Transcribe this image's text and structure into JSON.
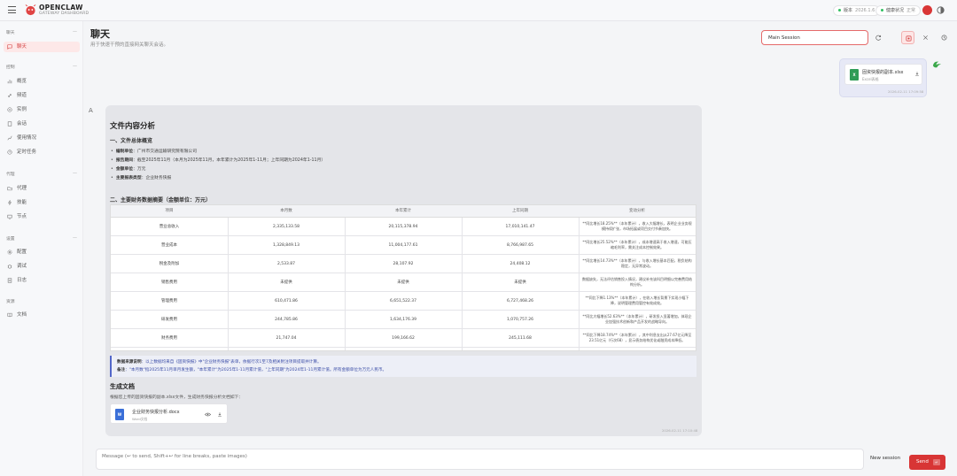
{
  "brand": {
    "title": "OPENCLAW",
    "subtitle": "GATEWAY DASHBOARD"
  },
  "topbar": {
    "version_label": "版本",
    "version_value": "2026.1.6",
    "health_label": "健康状况",
    "health_value": "正常",
    "status_color": "#2fbf5f"
  },
  "sidebar": {
    "sections": [
      {
        "label": "聊天",
        "items": [
          {
            "label": "聊天",
            "icon": "chat-icon",
            "active": true
          }
        ]
      },
      {
        "label": "控制",
        "items": [
          {
            "label": "概览",
            "icon": "bar-chart-icon"
          },
          {
            "label": "频道",
            "icon": "link-icon"
          },
          {
            "label": "实例",
            "icon": "radio-icon"
          },
          {
            "label": "会话",
            "icon": "document-icon"
          },
          {
            "label": "使用情况",
            "icon": "chart-icon"
          },
          {
            "label": "定时任务",
            "icon": "clock-icon"
          }
        ]
      },
      {
        "label": "代理",
        "items": [
          {
            "label": "代理",
            "icon": "folder-icon"
          },
          {
            "label": "技能",
            "icon": "bolt-icon"
          },
          {
            "label": "节点",
            "icon": "monitor-icon"
          }
        ]
      },
      {
        "label": "设置",
        "items": [
          {
            "label": "配置",
            "icon": "gear-icon"
          },
          {
            "label": "调试",
            "icon": "bug-icon"
          },
          {
            "label": "日志",
            "icon": "log-icon"
          }
        ]
      },
      {
        "label": "资源",
        "items": [
          {
            "label": "文档",
            "icon": "book-icon"
          }
        ]
      }
    ]
  },
  "page": {
    "title": "聊天",
    "subtitle": "用于快速干预的直接网关聊天会话。"
  },
  "session": {
    "value": "Main Session"
  },
  "user_message": {
    "file_name": "固资快报的副本.xlsx",
    "file_type": "Excel表格",
    "time": "2026-02-11 17:09:58"
  },
  "assistant": {
    "title": "文件内容分析",
    "section1": "一、文件总体概览",
    "overview": [
      {
        "key": "编制单位",
        "value": "广州市交通运输研究院有限公司"
      },
      {
        "key": "报告期间",
        "value": "截至2025年11月（本月为2025年11月，本年累计为2025年1-11月；上年同期为2024年1-11月）"
      },
      {
        "key": "金额单位",
        "value": "万元"
      },
      {
        "key": "主要报表类型",
        "value": "企业财务快报"
      }
    ],
    "section2": "二、主要财务数据摘要（金额单位：万元）",
    "table": {
      "headers": [
        "项目",
        "本月数",
        "本年累计",
        "上年同期",
        "变动分析"
      ],
      "rows": [
        {
          "item": "营业总收入",
          "month": "2,335,133.58",
          "ytd": "20,115,378.94",
          "prior": "17,010,141.47",
          "analysis": "**同比增长18.25%**（本年累计），收入大幅增长，表明企业业务规模持续扩张，市场拓展或项目交付节奏加快。"
        },
        {
          "item": "营业成本",
          "month": "1,328,849.13",
          "ytd": "11,004,177.61",
          "prior": "8,766,987.65",
          "analysis": "**同比增长25.52%**（本年累计），成本增速高于收入增速，可能压缩毛利率，需关注成本控制效果。"
        },
        {
          "item": "税金及附加",
          "month": "2,533.87",
          "ytd": "28,107.92",
          "prior": "24,408.12",
          "analysis": "**同比增长14.73%**（本年累计），与收入增长基本匹配，税负结构稳定，无异常波动。"
        },
        {
          "item": "销售费用",
          "month": "未提供",
          "ytd": "未提供",
          "prior": "未提供",
          "analysis": "数据缺失，无法评估销售投入情况，建议补充该科目明细以完善费用结构分析。"
        },
        {
          "item": "管理费用",
          "month": "610,471.86",
          "ytd": "6,651,522.37",
          "prior": "6,727,468.26",
          "analysis": "**同比下降1.13%**（本年累计），在收入增长背景下实现小幅下降，说明管理费用管控有效成效。"
        },
        {
          "item": "研发费用",
          "month": "244,785.86",
          "ytd": "1,634,176.39",
          "prior": "1,070,757.26",
          "analysis": "**同比大幅增长52.63%**（本年累计），研发投入显著增加，体现企业加强技术创新和产品开发的战略导向。"
        },
        {
          "item": "财务费用",
          "month": "21,747.04",
          "ytd": "199,166.62",
          "prior": "245,111.68",
          "analysis": "**同比下降18.74%**（本年累计），其中利息支出从27.67亿元降至23.51亿元（行次68），显示债务结构优化或融资成本降低。"
        }
      ]
    },
    "note": {
      "source_label": "数据来源说明",
      "source_text": "：以上数据均来自《固资快报》中\"企业财务快报\"表单，依据行次1至7及相关附注项目提取并计算。",
      "remark_label": "备注",
      "remark_text": "：\"本月数\"指2025年11月单月发生额，\"本年累计\"为2025年1-11月累计值，\"上年同期\"为2024年1-11月累计值。所有金额单位为万元人民币。"
    },
    "gen_title": "生成文档",
    "gen_desc": "根据您上传的固资快报的副本.xlsx文件，生成财务快报分析文档如下：",
    "file_name": "企业财务快报分析.docx",
    "file_type": "Word文档",
    "time": "2026-02-11 17:10:48"
  },
  "composer": {
    "placeholder": "Message (↩ to send, Shift+↩ for line breaks, paste images)",
    "new_session": "New session",
    "send": "Send"
  },
  "colors": {
    "accent": "#d83535",
    "note_blue": "#3d4fa8"
  }
}
